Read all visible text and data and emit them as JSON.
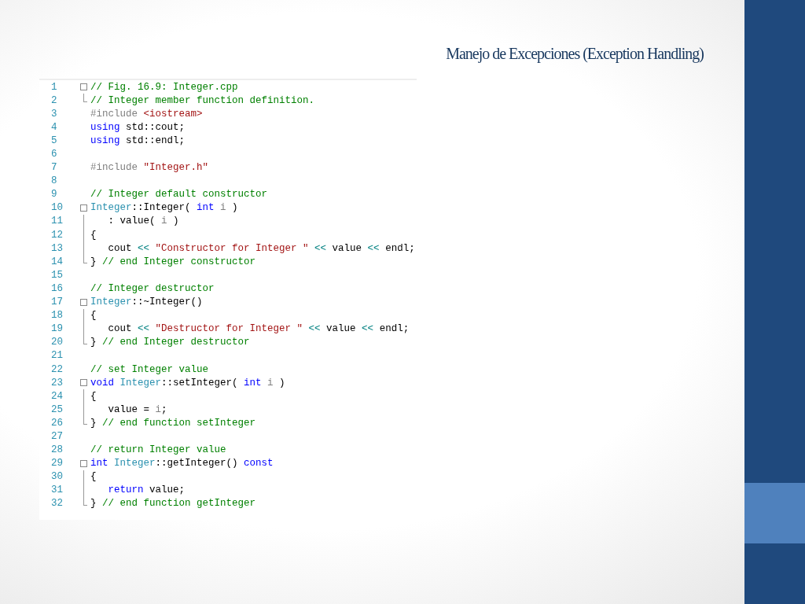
{
  "slide": {
    "title": "Manejo de Excepciones (Exception Handling)"
  },
  "code": {
    "lines": [
      {
        "number": "1",
        "kind": "fold-start",
        "tokens": [
          {
            "kind": "comment",
            "text": "// Fig. 16.9: Integer.cpp"
          }
        ]
      },
      {
        "number": "2",
        "kind": "fold-end",
        "tokens": [
          {
            "kind": "comment",
            "text": "// Integer member function definition."
          }
        ]
      },
      {
        "number": "3",
        "kind": "plain",
        "tokens": [
          {
            "kind": "preproc",
            "text": "#include "
          },
          {
            "kind": "string",
            "text": "<iostream>"
          }
        ]
      },
      {
        "number": "4",
        "kind": "plain",
        "tokens": [
          {
            "kind": "keyword",
            "text": "using"
          },
          {
            "kind": "plain",
            "text": " std::cout;"
          }
        ]
      },
      {
        "number": "5",
        "kind": "plain",
        "tokens": [
          {
            "kind": "keyword",
            "text": "using"
          },
          {
            "kind": "plain",
            "text": " std::endl;"
          }
        ]
      },
      {
        "number": "6",
        "kind": "plain"
      },
      {
        "number": "7",
        "kind": "plain",
        "tokens": [
          {
            "kind": "preproc",
            "text": "#include "
          },
          {
            "kind": "string",
            "text": "\"Integer.h\""
          }
        ]
      },
      {
        "number": "8",
        "kind": "plain"
      },
      {
        "number": "9",
        "kind": "plain",
        "tokens": [
          {
            "kind": "comment",
            "text": "// Integer default constructor"
          }
        ]
      },
      {
        "number": "10",
        "kind": "fold-start",
        "tokens": [
          {
            "kind": "type",
            "text": "Integer"
          },
          {
            "kind": "plain",
            "text": "::Integer( "
          },
          {
            "kind": "keyword",
            "text": "int"
          },
          {
            "kind": "param",
            "text": " i"
          },
          {
            "kind": "plain",
            "text": " )"
          }
        ]
      },
      {
        "number": "11",
        "kind": "fold-body",
        "tokens": [
          {
            "kind": "plain",
            "text": "   : value( "
          },
          {
            "kind": "param",
            "text": "i"
          },
          {
            "kind": "plain",
            "text": " )"
          }
        ]
      },
      {
        "number": "12",
        "kind": "fold-body",
        "tokens": [
          {
            "kind": "plain",
            "text": "{"
          }
        ]
      },
      {
        "number": "13",
        "kind": "fold-body",
        "tokens": [
          {
            "kind": "plain",
            "text": "   cout "
          },
          {
            "kind": "operator",
            "text": "<<"
          },
          {
            "kind": "string",
            "text": " \"Constructor for Integer \""
          },
          {
            "kind": "operator",
            "text": " <<"
          },
          {
            "kind": "plain",
            "text": " value "
          },
          {
            "kind": "operator",
            "text": "<<"
          },
          {
            "kind": "plain",
            "text": " endl;"
          }
        ]
      },
      {
        "number": "14",
        "kind": "fold-end",
        "tokens": [
          {
            "kind": "plain",
            "text": "} "
          },
          {
            "kind": "comment",
            "text": "// end Integer constructor"
          }
        ]
      },
      {
        "number": "15",
        "kind": "plain"
      },
      {
        "number": "16",
        "kind": "plain",
        "tokens": [
          {
            "kind": "comment",
            "text": "// Integer destructor"
          }
        ]
      },
      {
        "number": "17",
        "kind": "fold-start",
        "tokens": [
          {
            "kind": "type",
            "text": "Integer"
          },
          {
            "kind": "plain",
            "text": "::~Integer()"
          }
        ]
      },
      {
        "number": "18",
        "kind": "fold-body",
        "tokens": [
          {
            "kind": "plain",
            "text": "{"
          }
        ]
      },
      {
        "number": "19",
        "kind": "fold-body",
        "tokens": [
          {
            "kind": "plain",
            "text": "   cout "
          },
          {
            "kind": "operator",
            "text": "<<"
          },
          {
            "kind": "string",
            "text": " \"Destructor for Integer \""
          },
          {
            "kind": "operator",
            "text": " <<"
          },
          {
            "kind": "plain",
            "text": " value "
          },
          {
            "kind": "operator",
            "text": "<<"
          },
          {
            "kind": "plain",
            "text": " endl;"
          }
        ]
      },
      {
        "number": "20",
        "kind": "fold-end",
        "tokens": [
          {
            "kind": "plain",
            "text": "} "
          },
          {
            "kind": "comment",
            "text": "// end Integer destructor"
          }
        ]
      },
      {
        "number": "21",
        "kind": "plain"
      },
      {
        "number": "22",
        "kind": "plain",
        "tokens": [
          {
            "kind": "comment",
            "text": "// set Integer value"
          }
        ]
      },
      {
        "number": "23",
        "kind": "fold-start",
        "tokens": [
          {
            "kind": "keyword",
            "text": "void "
          },
          {
            "kind": "type",
            "text": "Integer"
          },
          {
            "kind": "plain",
            "text": "::setInteger( "
          },
          {
            "kind": "keyword",
            "text": "int"
          },
          {
            "kind": "param",
            "text": " i"
          },
          {
            "kind": "plain",
            "text": " )"
          }
        ]
      },
      {
        "number": "24",
        "kind": "fold-body",
        "tokens": [
          {
            "kind": "plain",
            "text": "{"
          }
        ]
      },
      {
        "number": "25",
        "kind": "fold-body",
        "tokens": [
          {
            "kind": "plain",
            "text": "   value = "
          },
          {
            "kind": "param",
            "text": "i"
          },
          {
            "kind": "plain",
            "text": ";"
          }
        ]
      },
      {
        "number": "26",
        "kind": "fold-end",
        "tokens": [
          {
            "kind": "plain",
            "text": "} "
          },
          {
            "kind": "comment",
            "text": "// end function setInteger"
          }
        ]
      },
      {
        "number": "27",
        "kind": "plain"
      },
      {
        "number": "28",
        "kind": "plain",
        "tokens": [
          {
            "kind": "comment",
            "text": "// return Integer value"
          }
        ]
      },
      {
        "number": "29",
        "kind": "fold-start",
        "tokens": [
          {
            "kind": "keyword",
            "text": "int "
          },
          {
            "kind": "type",
            "text": "Integer"
          },
          {
            "kind": "plain",
            "text": "::getInteger() "
          },
          {
            "kind": "keyword",
            "text": "const"
          }
        ]
      },
      {
        "number": "30",
        "kind": "fold-body",
        "tokens": [
          {
            "kind": "plain",
            "text": "{"
          }
        ]
      },
      {
        "number": "31",
        "kind": "fold-body",
        "tokens": [
          {
            "kind": "keyword",
            "text": "   return"
          },
          {
            "kind": "plain",
            "text": " value;"
          }
        ]
      },
      {
        "number": "32",
        "kind": "fold-end",
        "tokens": [
          {
            "kind": "plain",
            "text": "} "
          },
          {
            "kind": "comment",
            "text": "// end function getInteger"
          }
        ]
      }
    ]
  }
}
